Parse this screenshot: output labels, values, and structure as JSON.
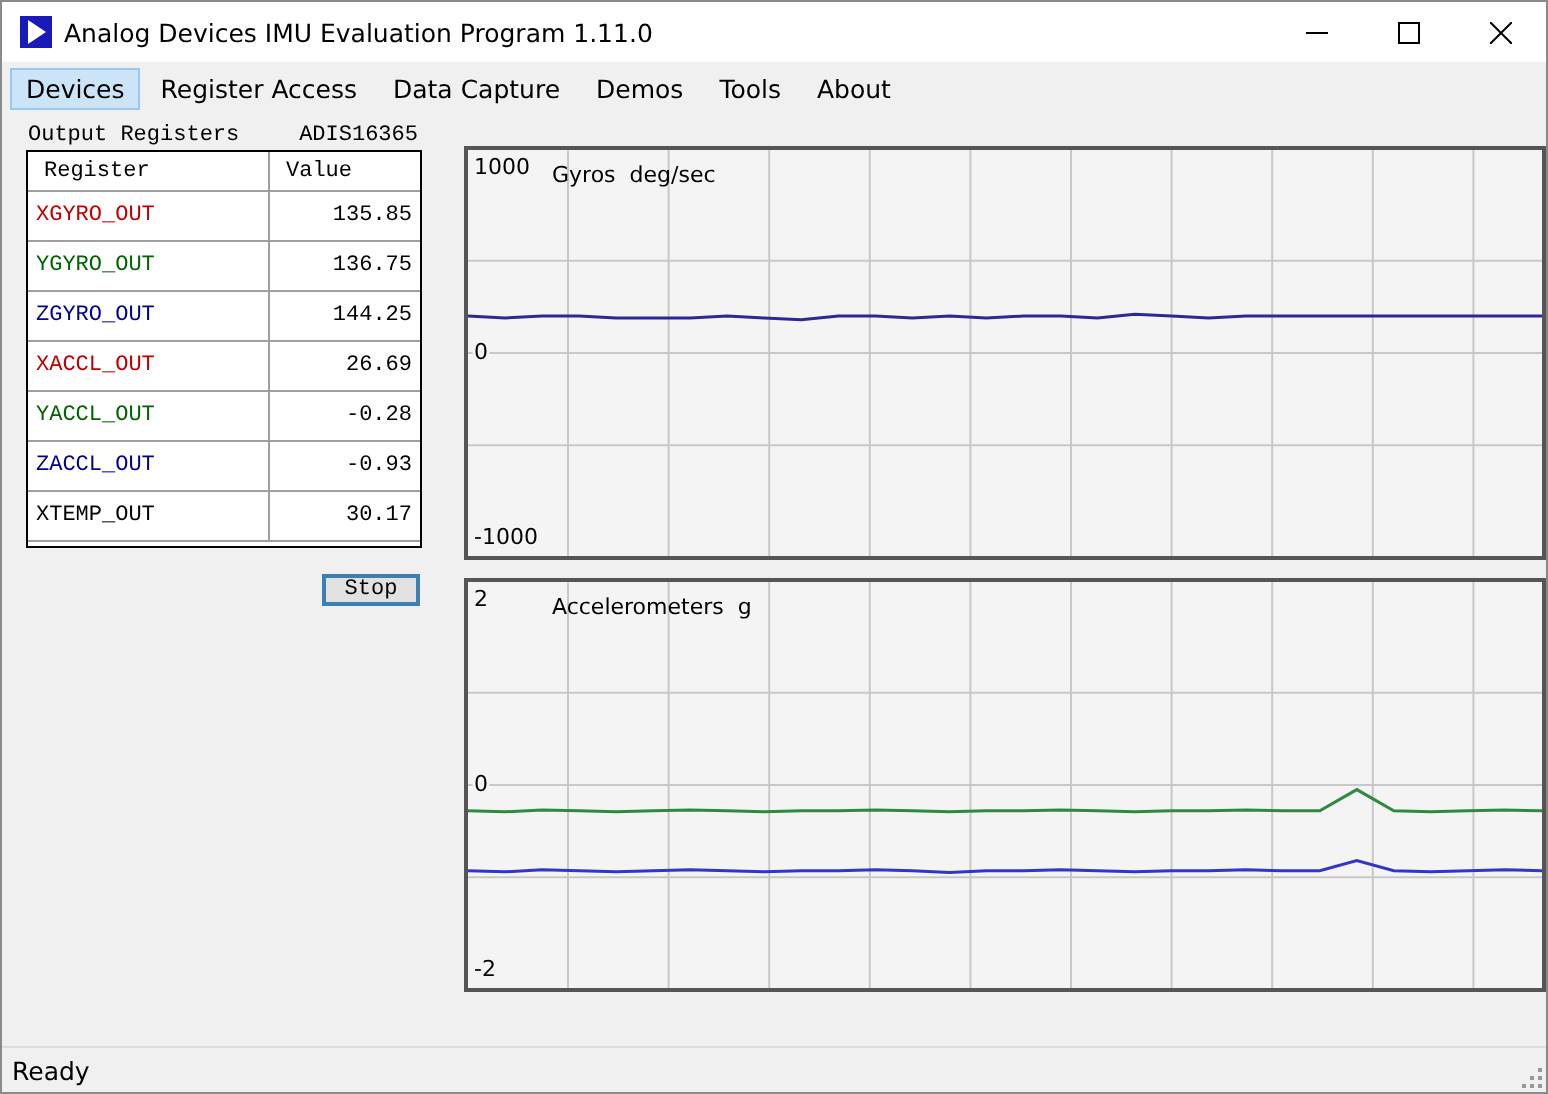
{
  "window": {
    "title": "Analog Devices IMU Evaluation Program  1.11.0"
  },
  "menu": [
    {
      "label": "Devices",
      "selected": true
    },
    {
      "label": "Register Access",
      "selected": false
    },
    {
      "label": "Data Capture",
      "selected": false
    },
    {
      "label": "Demos",
      "selected": false
    },
    {
      "label": "Tools",
      "selected": false
    },
    {
      "label": "About",
      "selected": false
    }
  ],
  "output_registers": {
    "label": "Output Registers",
    "device": "ADIS16365",
    "columns": [
      "Register",
      "Value"
    ],
    "rows": [
      {
        "register": "XGYRO_OUT",
        "value": "135.85",
        "color": "#c00000"
      },
      {
        "register": "YGYRO_OUT",
        "value": "136.75",
        "color": "#006400"
      },
      {
        "register": "ZGYRO_OUT",
        "value": "144.25",
        "color": "#00008b"
      },
      {
        "register": "XACCL_OUT",
        "value": "26.69",
        "color": "#c00000"
      },
      {
        "register": "YACCL_OUT",
        "value": "-0.28",
        "color": "#006400"
      },
      {
        "register": "ZACCL_OUT",
        "value": "-0.93",
        "color": "#00008b"
      },
      {
        "register": "XTEMP_OUT",
        "value": "30.17",
        "color": "#000000"
      }
    ]
  },
  "stop_button": {
    "label": "Stop"
  },
  "charts": [
    {
      "chart_data": {
        "type": "line",
        "title": "Gyros  deg/sec",
        "ylim": [
          -1100,
          1100
        ],
        "yticks": [
          1000,
          0,
          -1000
        ],
        "series": [
          {
            "color": "#2a2a96",
            "values": [
              200,
              190,
              200,
              200,
              190,
              190,
              190,
              200,
              190,
              180,
              200,
              200,
              190,
              200,
              190,
              200,
              200,
              190,
              210,
              200,
              190,
              200,
              200,
              200,
              200,
              200,
              200,
              200,
              200,
              200
            ]
          }
        ]
      }
    },
    {
      "chart_data": {
        "type": "line",
        "title": "Accelerometers  g",
        "ylim": [
          -2.2,
          2.2
        ],
        "yticks": [
          2,
          0,
          -2
        ],
        "series": [
          {
            "color": "#2e8b3e",
            "values": [
              -0.28,
              -0.29,
              -0.27,
              -0.28,
              -0.29,
              -0.28,
              -0.27,
              -0.28,
              -0.29,
              -0.28,
              -0.28,
              -0.27,
              -0.28,
              -0.29,
              -0.28,
              -0.28,
              -0.27,
              -0.28,
              -0.29,
              -0.28,
              -0.28,
              -0.27,
              -0.28,
              -0.28,
              -0.05,
              -0.28,
              -0.29,
              -0.28,
              -0.27,
              -0.28
            ]
          },
          {
            "color": "#3434c8",
            "values": [
              -0.93,
              -0.94,
              -0.92,
              -0.93,
              -0.94,
              -0.93,
              -0.92,
              -0.93,
              -0.94,
              -0.93,
              -0.93,
              -0.92,
              -0.93,
              -0.95,
              -0.93,
              -0.93,
              -0.92,
              -0.93,
              -0.94,
              -0.93,
              -0.93,
              -0.92,
              -0.93,
              -0.93,
              -0.82,
              -0.93,
              -0.94,
              -0.93,
              -0.92,
              -0.93
            ]
          }
        ]
      }
    }
  ],
  "status_bar": {
    "text": "Ready"
  }
}
